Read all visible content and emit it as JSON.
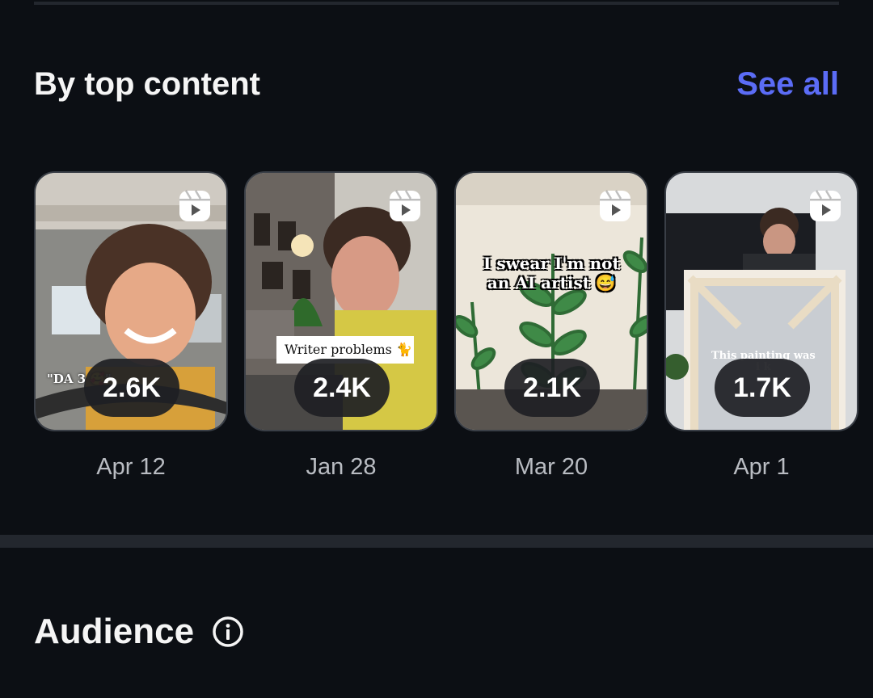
{
  "top_content": {
    "title": "By top content",
    "see_all_label": "See all",
    "items": [
      {
        "count": "2.6K",
        "date": "Apr 12",
        "caption": "\"DA                 3 🥰\"",
        "icon": "reel-icon"
      },
      {
        "count": "2.4K",
        "date": "Jan 28",
        "caption": "Writer problems 🐈",
        "icon": "reel-icon"
      },
      {
        "count": "2.1K",
        "date": "Mar 20",
        "caption_line1": "I swear I'm not",
        "caption_line2": "an AI artist 😅",
        "icon": "reel-icon"
      },
      {
        "count": "1.7K",
        "date": "Apr 1",
        "caption_line1": "This painting was",
        "caption_line2": "i                 k",
        "icon": "reel-icon"
      }
    ]
  },
  "audience": {
    "title": "Audience",
    "icon": "info-icon"
  },
  "colors": {
    "background": "#0c0f14",
    "accent": "#5b6cf6",
    "divider": "#23272e",
    "pill": "#1e2024"
  }
}
